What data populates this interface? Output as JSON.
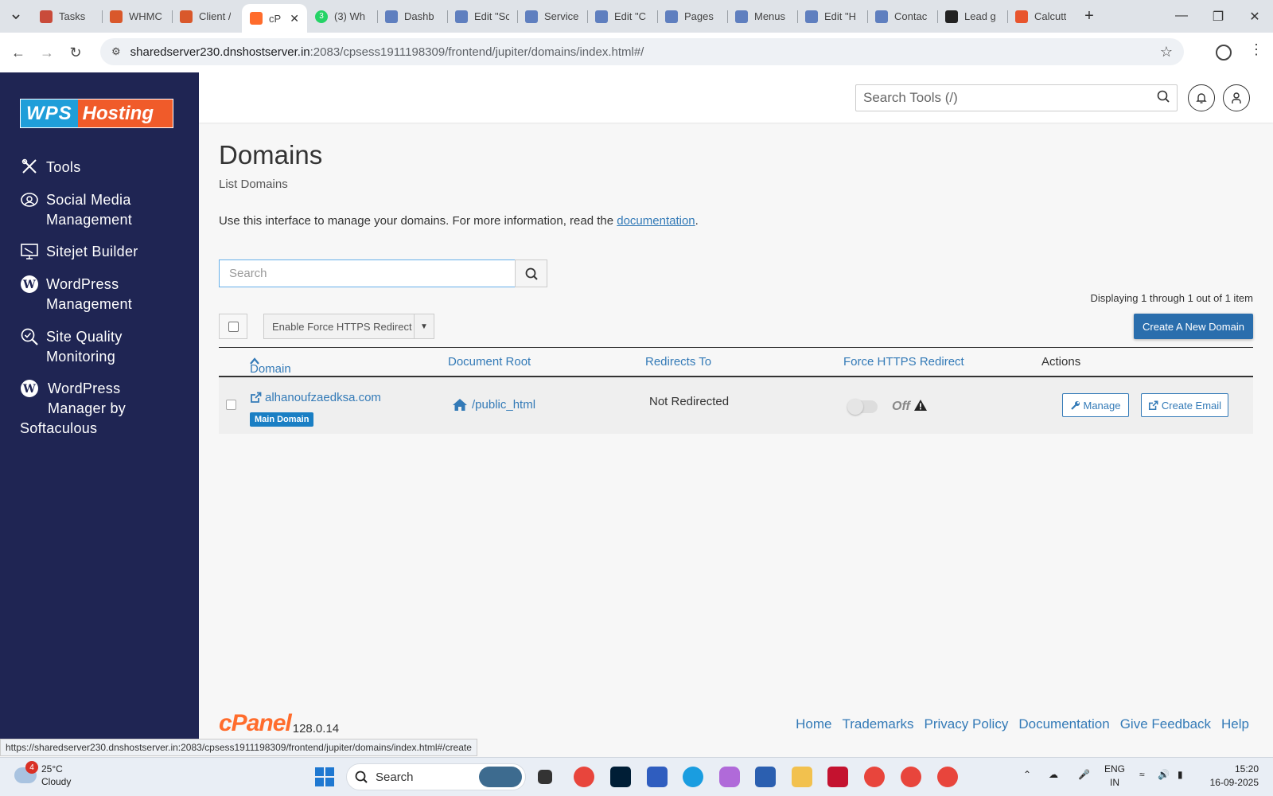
{
  "browser": {
    "tabs": [
      {
        "label": "Tasks",
        "color": "#c94b3a"
      },
      {
        "label": "WHMC",
        "color": "#d9582b"
      },
      {
        "label": "Client /",
        "color": "#d9582b"
      },
      {
        "label": "cP",
        "color": "#ff6c2c",
        "active": true
      },
      {
        "label": "(3) Wh",
        "color": "#25d366",
        "badge": "3"
      },
      {
        "label": "Dashb",
        "color": "#5f7fbf"
      },
      {
        "label": "Edit \"Sc",
        "color": "#5f7fbf"
      },
      {
        "label": "Service",
        "color": "#5f7fbf"
      },
      {
        "label": "Edit \"C",
        "color": "#5f7fbf"
      },
      {
        "label": "Pages",
        "color": "#5f7fbf"
      },
      {
        "label": "Menus",
        "color": "#5f7fbf"
      },
      {
        "label": "Edit \"H",
        "color": "#5f7fbf"
      },
      {
        "label": "Contac",
        "color": "#5f7fbf"
      },
      {
        "label": "Lead g",
        "color": "#222222"
      },
      {
        "label": "Calcutt",
        "color": "#e8552d"
      }
    ],
    "url_host": "sharedserver230.dnshostserver.in",
    "url_path": ":2083/cpsess1911198309/frontend/jupiter/domains/index.html#/",
    "status_url": "https://sharedserver230.dnshostserver.in:2083/cpsess1911198309/frontend/jupiter/domains/index.html#/create"
  },
  "sidebar": {
    "logo_left": "WPS",
    "logo_right": "Hosting",
    "items": [
      {
        "line1": "Tools",
        "line2": "",
        "icon": "tools-icon"
      },
      {
        "line1": "Social Media",
        "line2": "Management",
        "icon": "social-media-icon"
      },
      {
        "line1": "Sitejet Builder",
        "line2": "",
        "icon": "sitejet-icon"
      },
      {
        "line1": "WordPress",
        "line2": "Management",
        "icon": "wordpress-icon"
      },
      {
        "line1": "Site Quality",
        "line2": "Monitoring",
        "icon": "site-quality-icon"
      },
      {
        "line1": "WordPress",
        "line2": "Manager by",
        "line3": "Softaculous",
        "icon": "wordpress-icon"
      }
    ]
  },
  "header": {
    "search_placeholder": "Search Tools (/)"
  },
  "page": {
    "title": "Domains",
    "subtitle": "List Domains",
    "intro_text": "Use this interface to manage your domains. For more information, read the ",
    "intro_link": "documentation",
    "intro_end": ".",
    "search_placeholder": "Search",
    "displaying": "Displaying 1 through 1 out of 1 item",
    "force_https_btn": "Enable Force HTTPS Redirect",
    "create_btn": "Create A New Domain",
    "columns": {
      "domain": "Domain",
      "docroot": "Document Root",
      "redirects": "Redirects To",
      "force": "Force HTTPS Redirect",
      "actions": "Actions"
    },
    "rows": [
      {
        "domain": "alhanoufzaedksa.com",
        "badge": "Main Domain",
        "docroot": "/public_html",
        "redirects": "Not Redirected",
        "force_state": "Off",
        "manage": "Manage",
        "create_email": "Create Email"
      }
    ]
  },
  "footer": {
    "logo": "cPanel",
    "version": "128.0.14",
    "links": [
      "Home",
      "Trademarks",
      "Privacy Policy",
      "Documentation",
      "Give Feedback",
      "Help"
    ]
  },
  "taskbar": {
    "temp": "25°C",
    "weather": "Cloudy",
    "weather_badge": "4",
    "search": "Search",
    "lang1": "ENG",
    "lang2": "IN",
    "time": "15:20",
    "date": "16-09-2025"
  }
}
